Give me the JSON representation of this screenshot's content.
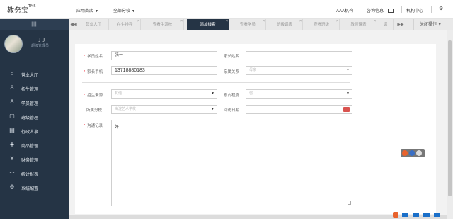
{
  "header": {
    "brand": "教务宝",
    "brand_sup": "TMS",
    "menus": [
      {
        "label": "应用商店"
      },
      {
        "label": "全部分校"
      }
    ],
    "org": "AAA机构",
    "consult": "咨询信息",
    "center": "机构中心"
  },
  "sidebar": {
    "toggle": "|||",
    "user_name": "丁丁",
    "user_role": "超级管理员",
    "items": [
      {
        "label": "营业大厅",
        "icon": "home-icon"
      },
      {
        "label": "招生管理",
        "icon": "user-plus-icon"
      },
      {
        "label": "学员管理",
        "icon": "user-icon"
      },
      {
        "label": "班级管理",
        "icon": "class-icon"
      },
      {
        "label": "行政人事",
        "icon": "admin-icon"
      },
      {
        "label": "商品管理",
        "icon": "tag-icon"
      },
      {
        "label": "财务管理",
        "icon": "yen-icon"
      },
      {
        "label": "统计报表",
        "icon": "chart-icon"
      },
      {
        "label": "系统配置",
        "icon": "settings-icon"
      }
    ]
  },
  "tabs": [
    {
      "label": "营业大厅"
    },
    {
      "label": "在生排程"
    },
    {
      "label": "查看生源校"
    },
    {
      "label": "添加线索"
    },
    {
      "label": "查看学员"
    },
    {
      "label": "班级课表"
    },
    {
      "label": "查看班级"
    },
    {
      "label": "教师课表"
    },
    {
      "label": "课"
    }
  ],
  "tab_close_ops": "关闭操作",
  "form": {
    "student_name_label": "学员姓名",
    "student_name_value": "张一",
    "parent_name_label": "家长姓名",
    "parent_name_value": "",
    "parent_phone_label": "家长手机",
    "parent_phone_value": "13718880183",
    "relation_label": "亲属关系",
    "relation_value": "母亲",
    "source_label": "招生来源",
    "source_value": "其他",
    "intent_label": "意向程度",
    "intent_value": "弱",
    "campus_label": "所属分校",
    "campus_value": "海淀艺术学校",
    "revisit_label": "回访日期",
    "revisit_value": "",
    "notes_label": "沟通记录",
    "notes_value": "好"
  },
  "colors": {
    "sidebar_bg": "#253445",
    "active_tab": "#253445",
    "required": "#ee2233"
  }
}
